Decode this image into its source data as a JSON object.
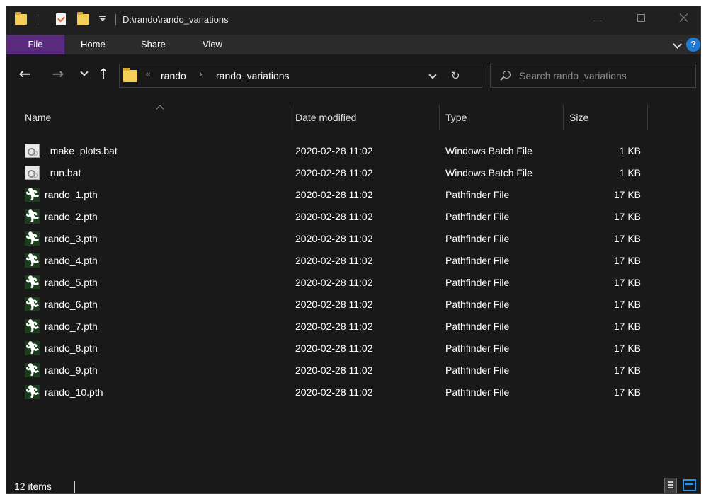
{
  "window": {
    "title": "D:\\rando\\rando_variations"
  },
  "ribbon": {
    "tabs": [
      "File",
      "Home",
      "Share",
      "View"
    ]
  },
  "nav": {
    "back_glyph": "←",
    "forward_glyph": "→",
    "up_glyph": "↑",
    "overflow_glyph": "«",
    "breadcrumb": [
      "rando",
      "rando_variations"
    ],
    "crumb_separator": "›",
    "refresh_glyph": "↻"
  },
  "search": {
    "placeholder": "Search rando_variations"
  },
  "columns": {
    "name": "Name",
    "date": "Date modified",
    "type": "Type",
    "size": "Size"
  },
  "files": [
    {
      "icon": "batch-file-icon",
      "name": "_make_plots.bat",
      "date": "2020-02-28 11:02",
      "type": "Windows Batch File",
      "size": "1 KB"
    },
    {
      "icon": "batch-file-icon",
      "name": "_run.bat",
      "date": "2020-02-28 11:02",
      "type": "Windows Batch File",
      "size": "1 KB"
    },
    {
      "icon": "pathfinder-file-icon",
      "name": "rando_1.pth",
      "date": "2020-02-28 11:02",
      "type": "Pathfinder File",
      "size": "17 KB"
    },
    {
      "icon": "pathfinder-file-icon",
      "name": "rando_2.pth",
      "date": "2020-02-28 11:02",
      "type": "Pathfinder File",
      "size": "17 KB"
    },
    {
      "icon": "pathfinder-file-icon",
      "name": "rando_3.pth",
      "date": "2020-02-28 11:02",
      "type": "Pathfinder File",
      "size": "17 KB"
    },
    {
      "icon": "pathfinder-file-icon",
      "name": "rando_4.pth",
      "date": "2020-02-28 11:02",
      "type": "Pathfinder File",
      "size": "17 KB"
    },
    {
      "icon": "pathfinder-file-icon",
      "name": "rando_5.pth",
      "date": "2020-02-28 11:02",
      "type": "Pathfinder File",
      "size": "17 KB"
    },
    {
      "icon": "pathfinder-file-icon",
      "name": "rando_6.pth",
      "date": "2020-02-28 11:02",
      "type": "Pathfinder File",
      "size": "17 KB"
    },
    {
      "icon": "pathfinder-file-icon",
      "name": "rando_7.pth",
      "date": "2020-02-28 11:02",
      "type": "Pathfinder File",
      "size": "17 KB"
    },
    {
      "icon": "pathfinder-file-icon",
      "name": "rando_8.pth",
      "date": "2020-02-28 11:02",
      "type": "Pathfinder File",
      "size": "17 KB"
    },
    {
      "icon": "pathfinder-file-icon",
      "name": "rando_9.pth",
      "date": "2020-02-28 11:02",
      "type": "Pathfinder File",
      "size": "17 KB"
    },
    {
      "icon": "pathfinder-file-icon",
      "name": "rando_10.pth",
      "date": "2020-02-28 11:02",
      "type": "Pathfinder File",
      "size": "17 KB"
    }
  ],
  "status": {
    "item_count": "12 items"
  },
  "colors": {
    "background": "#191919",
    "file_tab": "#5a2a7e",
    "folder": "#f6cf56",
    "accent_blue": "#2f8fe0",
    "pathfinder_icon_bg": "#1a3d1c"
  }
}
